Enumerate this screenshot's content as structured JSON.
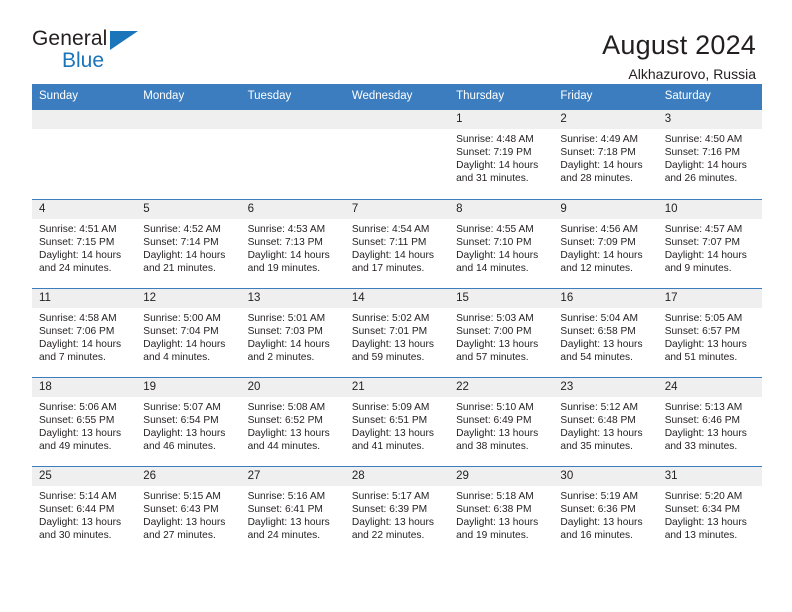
{
  "logo": {
    "line1": "General",
    "line2": "Blue",
    "triangle_icon": "triangle-icon",
    "color_dark": "#231f20",
    "color_blue": "#1b75bb"
  },
  "header": {
    "title": "August 2024",
    "subtitle": "Alkhazurovo, Russia",
    "accent_color": "#3b7dbf",
    "band_color": "#efefef"
  },
  "weekdays": [
    "Sunday",
    "Monday",
    "Tuesday",
    "Wednesday",
    "Thursday",
    "Friday",
    "Saturday"
  ],
  "weeks": [
    [
      {
        "day": "",
        "empty": true
      },
      {
        "day": "",
        "empty": true
      },
      {
        "day": "",
        "empty": true
      },
      {
        "day": "",
        "empty": true
      },
      {
        "day": "1",
        "sunrise": "Sunrise: 4:48 AM",
        "sunset": "Sunset: 7:19 PM",
        "daylight1": "Daylight: 14 hours",
        "daylight2": "and 31 minutes."
      },
      {
        "day": "2",
        "sunrise": "Sunrise: 4:49 AM",
        "sunset": "Sunset: 7:18 PM",
        "daylight1": "Daylight: 14 hours",
        "daylight2": "and 28 minutes."
      },
      {
        "day": "3",
        "sunrise": "Sunrise: 4:50 AM",
        "sunset": "Sunset: 7:16 PM",
        "daylight1": "Daylight: 14 hours",
        "daylight2": "and 26 minutes."
      }
    ],
    [
      {
        "day": "4",
        "sunrise": "Sunrise: 4:51 AM",
        "sunset": "Sunset: 7:15 PM",
        "daylight1": "Daylight: 14 hours",
        "daylight2": "and 24 minutes."
      },
      {
        "day": "5",
        "sunrise": "Sunrise: 4:52 AM",
        "sunset": "Sunset: 7:14 PM",
        "daylight1": "Daylight: 14 hours",
        "daylight2": "and 21 minutes."
      },
      {
        "day": "6",
        "sunrise": "Sunrise: 4:53 AM",
        "sunset": "Sunset: 7:13 PM",
        "daylight1": "Daylight: 14 hours",
        "daylight2": "and 19 minutes."
      },
      {
        "day": "7",
        "sunrise": "Sunrise: 4:54 AM",
        "sunset": "Sunset: 7:11 PM",
        "daylight1": "Daylight: 14 hours",
        "daylight2": "and 17 minutes."
      },
      {
        "day": "8",
        "sunrise": "Sunrise: 4:55 AM",
        "sunset": "Sunset: 7:10 PM",
        "daylight1": "Daylight: 14 hours",
        "daylight2": "and 14 minutes."
      },
      {
        "day": "9",
        "sunrise": "Sunrise: 4:56 AM",
        "sunset": "Sunset: 7:09 PM",
        "daylight1": "Daylight: 14 hours",
        "daylight2": "and 12 minutes."
      },
      {
        "day": "10",
        "sunrise": "Sunrise: 4:57 AM",
        "sunset": "Sunset: 7:07 PM",
        "daylight1": "Daylight: 14 hours",
        "daylight2": "and 9 minutes."
      }
    ],
    [
      {
        "day": "11",
        "sunrise": "Sunrise: 4:58 AM",
        "sunset": "Sunset: 7:06 PM",
        "daylight1": "Daylight: 14 hours",
        "daylight2": "and 7 minutes."
      },
      {
        "day": "12",
        "sunrise": "Sunrise: 5:00 AM",
        "sunset": "Sunset: 7:04 PM",
        "daylight1": "Daylight: 14 hours",
        "daylight2": "and 4 minutes."
      },
      {
        "day": "13",
        "sunrise": "Sunrise: 5:01 AM",
        "sunset": "Sunset: 7:03 PM",
        "daylight1": "Daylight: 14 hours",
        "daylight2": "and 2 minutes."
      },
      {
        "day": "14",
        "sunrise": "Sunrise: 5:02 AM",
        "sunset": "Sunset: 7:01 PM",
        "daylight1": "Daylight: 13 hours",
        "daylight2": "and 59 minutes."
      },
      {
        "day": "15",
        "sunrise": "Sunrise: 5:03 AM",
        "sunset": "Sunset: 7:00 PM",
        "daylight1": "Daylight: 13 hours",
        "daylight2": "and 57 minutes."
      },
      {
        "day": "16",
        "sunrise": "Sunrise: 5:04 AM",
        "sunset": "Sunset: 6:58 PM",
        "daylight1": "Daylight: 13 hours",
        "daylight2": "and 54 minutes."
      },
      {
        "day": "17",
        "sunrise": "Sunrise: 5:05 AM",
        "sunset": "Sunset: 6:57 PM",
        "daylight1": "Daylight: 13 hours",
        "daylight2": "and 51 minutes."
      }
    ],
    [
      {
        "day": "18",
        "sunrise": "Sunrise: 5:06 AM",
        "sunset": "Sunset: 6:55 PM",
        "daylight1": "Daylight: 13 hours",
        "daylight2": "and 49 minutes."
      },
      {
        "day": "19",
        "sunrise": "Sunrise: 5:07 AM",
        "sunset": "Sunset: 6:54 PM",
        "daylight1": "Daylight: 13 hours",
        "daylight2": "and 46 minutes."
      },
      {
        "day": "20",
        "sunrise": "Sunrise: 5:08 AM",
        "sunset": "Sunset: 6:52 PM",
        "daylight1": "Daylight: 13 hours",
        "daylight2": "and 44 minutes."
      },
      {
        "day": "21",
        "sunrise": "Sunrise: 5:09 AM",
        "sunset": "Sunset: 6:51 PM",
        "daylight1": "Daylight: 13 hours",
        "daylight2": "and 41 minutes."
      },
      {
        "day": "22",
        "sunrise": "Sunrise: 5:10 AM",
        "sunset": "Sunset: 6:49 PM",
        "daylight1": "Daylight: 13 hours",
        "daylight2": "and 38 minutes."
      },
      {
        "day": "23",
        "sunrise": "Sunrise: 5:12 AM",
        "sunset": "Sunset: 6:48 PM",
        "daylight1": "Daylight: 13 hours",
        "daylight2": "and 35 minutes."
      },
      {
        "day": "24",
        "sunrise": "Sunrise: 5:13 AM",
        "sunset": "Sunset: 6:46 PM",
        "daylight1": "Daylight: 13 hours",
        "daylight2": "and 33 minutes."
      }
    ],
    [
      {
        "day": "25",
        "sunrise": "Sunrise: 5:14 AM",
        "sunset": "Sunset: 6:44 PM",
        "daylight1": "Daylight: 13 hours",
        "daylight2": "and 30 minutes."
      },
      {
        "day": "26",
        "sunrise": "Sunrise: 5:15 AM",
        "sunset": "Sunset: 6:43 PM",
        "daylight1": "Daylight: 13 hours",
        "daylight2": "and 27 minutes."
      },
      {
        "day": "27",
        "sunrise": "Sunrise: 5:16 AM",
        "sunset": "Sunset: 6:41 PM",
        "daylight1": "Daylight: 13 hours",
        "daylight2": "and 24 minutes."
      },
      {
        "day": "28",
        "sunrise": "Sunrise: 5:17 AM",
        "sunset": "Sunset: 6:39 PM",
        "daylight1": "Daylight: 13 hours",
        "daylight2": "and 22 minutes."
      },
      {
        "day": "29",
        "sunrise": "Sunrise: 5:18 AM",
        "sunset": "Sunset: 6:38 PM",
        "daylight1": "Daylight: 13 hours",
        "daylight2": "and 19 minutes."
      },
      {
        "day": "30",
        "sunrise": "Sunrise: 5:19 AM",
        "sunset": "Sunset: 6:36 PM",
        "daylight1": "Daylight: 13 hours",
        "daylight2": "and 16 minutes."
      },
      {
        "day": "31",
        "sunrise": "Sunrise: 5:20 AM",
        "sunset": "Sunset: 6:34 PM",
        "daylight1": "Daylight: 13 hours",
        "daylight2": "and 13 minutes."
      }
    ]
  ]
}
